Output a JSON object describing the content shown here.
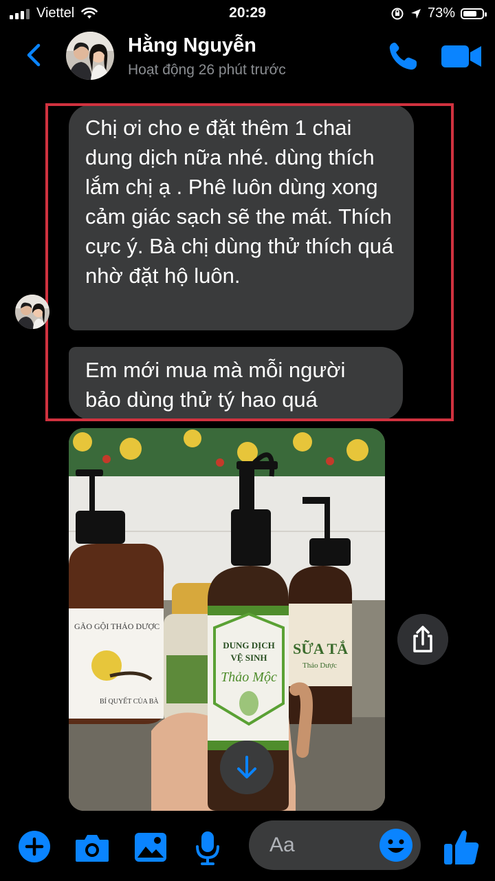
{
  "status_bar": {
    "carrier": "Viettel",
    "time": "20:29",
    "battery": "73%",
    "battery_level": 0.73
  },
  "header": {
    "contact_name": "Hằng Nguyễn",
    "activity": "Hoạt động 26 phút trước"
  },
  "messages": [
    {
      "text": "Chị ơi cho e đặt thêm 1 chai dung dịch nữa nhé.  dùng thích lắm chị ạ . Phê luôn dùng xong cảm giác sạch sẽ the mát. Thích cực ý. Bà chị dùng thử thích quá nhờ đặt hộ luôn."
    },
    {
      "text": "Em mới mua mà mỗi người bảo dùng thử tý hao quá"
    }
  ],
  "photo": {
    "bottle_left_label": "GÃO GỘI THẢO DƯỢC",
    "bottle_left_sub": "BÍ QUYẾT CỦA BÀ",
    "bottle_main_line1": "DUNG DỊCH",
    "bottle_main_line2": "VỆ SINH",
    "bottle_main_script": "Thảo Mộc",
    "bottle_right_label": "SỮA TẮ",
    "bottle_right_sub": "Thảo Dược"
  },
  "composer": {
    "placeholder": "Aa"
  },
  "colors": {
    "accent": "#0a84ff",
    "bubble": "#3a3b3c",
    "highlight_border": "#d0323f"
  },
  "icons": [
    "back-chevron-icon",
    "phone-icon",
    "video-camera-icon",
    "share-icon",
    "arrow-down-icon",
    "plus-icon",
    "camera-icon",
    "gallery-icon",
    "microphone-icon",
    "emoji-icon",
    "thumbs-up-icon"
  ]
}
